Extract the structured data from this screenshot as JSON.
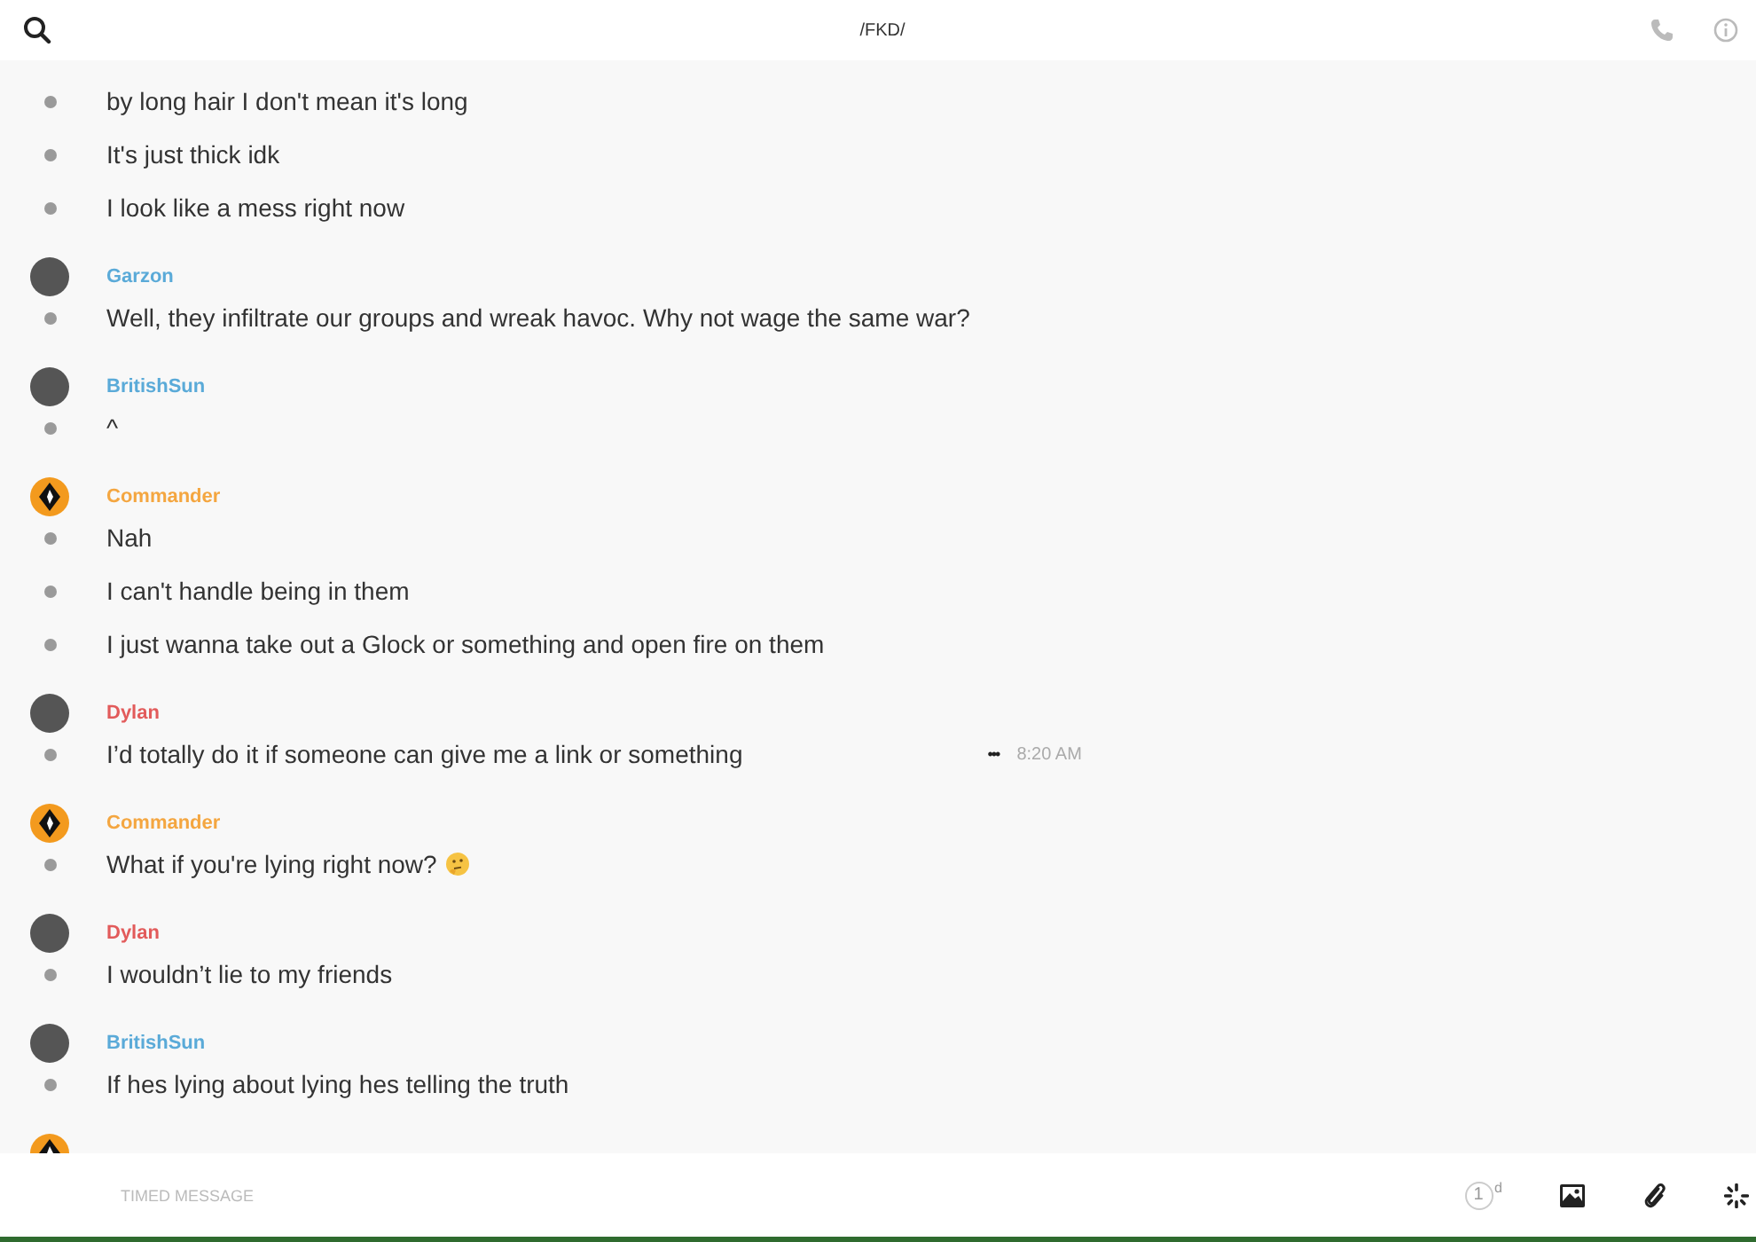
{
  "header": {
    "title": "/FKD/"
  },
  "groups": [
    {
      "lines": [
        {
          "text": "by long hair I don't mean it's long"
        },
        {
          "text": "It's just thick idk"
        },
        {
          "text": "I look like a mess right now"
        }
      ]
    },
    {
      "author": {
        "name": "Garzon",
        "color": "#5aaad8",
        "kind": "photo"
      },
      "lines": [
        {
          "text": "Well, they infiltrate our groups and wreak havoc. Why not wage the same war?"
        }
      ]
    },
    {
      "author": {
        "name": "BritishSun",
        "color": "#5aaad8",
        "kind": "photo"
      },
      "lines": [
        {
          "text": "^"
        }
      ]
    },
    {
      "author": {
        "name": "Commander",
        "color": "#f4a640",
        "kind": "emblem"
      },
      "lines": [
        {
          "text": "Nah"
        },
        {
          "text": "I can't handle being in them"
        },
        {
          "text": "I just wanna take out a Glock or something and open fire on them"
        }
      ]
    },
    {
      "author": {
        "name": "Dylan",
        "color": "#e25b5b",
        "kind": "photo"
      },
      "lines": [
        {
          "text": "I’d totally do it if someone can give me a link or something",
          "actions": "•••",
          "time": "8:20 AM"
        }
      ]
    },
    {
      "author": {
        "name": "Commander",
        "color": "#f4a640",
        "kind": "emblem"
      },
      "lines": [
        {
          "text": "What if you're lying right now?",
          "emoji": true
        }
      ]
    },
    {
      "author": {
        "name": "Dylan",
        "color": "#e25b5b",
        "kind": "photo"
      },
      "lines": [
        {
          "text": "I wouldn’t lie to my friends"
        }
      ]
    },
    {
      "author": {
        "name": "BritishSun",
        "color": "#5aaad8",
        "kind": "photo"
      },
      "lines": [
        {
          "text": "If hes lying about lying hes telling the truth"
        }
      ]
    },
    {
      "author": {
        "kind": "emblem"
      }
    }
  ],
  "composer": {
    "placeholder": "TIMED MESSAGE",
    "timer": {
      "value": "1",
      "unit": "d"
    }
  }
}
